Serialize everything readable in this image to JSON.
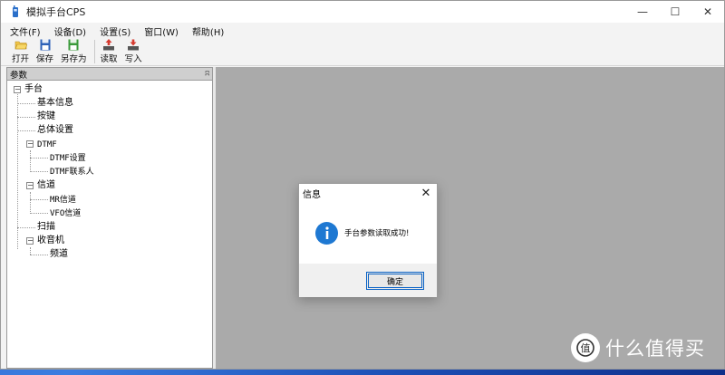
{
  "window": {
    "title": "模拟手台CPS",
    "controls": {
      "minimize": "—",
      "maximize": "☐",
      "close": "✕"
    }
  },
  "menu": [
    "文件(F)",
    "设备(D)",
    "设置(S)",
    "窗口(W)",
    "帮助(H)"
  ],
  "toolbar": {
    "open": "打开",
    "save": "保存",
    "save_as": "另存为",
    "read": "读取",
    "write": "写入"
  },
  "panel": {
    "title": "参数",
    "pin": "ʭ",
    "tree": {
      "root": "手台",
      "basic_info": "基本信息",
      "keys": "按键",
      "general": "总体设置",
      "dtmf": "DTMF",
      "dtmf_settings": "DTMF设置",
      "dtmf_contacts": "DTMF联系人",
      "channels": "信道",
      "mr_channels": "MR信道",
      "vfo_channels": "VFO信道",
      "scan": "扫描",
      "radio": "收音机",
      "frequency": "频道"
    }
  },
  "dialog": {
    "title": "信息",
    "close": "✕",
    "message": "手台参数读取成功!",
    "ok": "确定",
    "icon_color": "#1e78d2"
  },
  "watermark": {
    "text": "什么值得买",
    "logo": "值"
  }
}
